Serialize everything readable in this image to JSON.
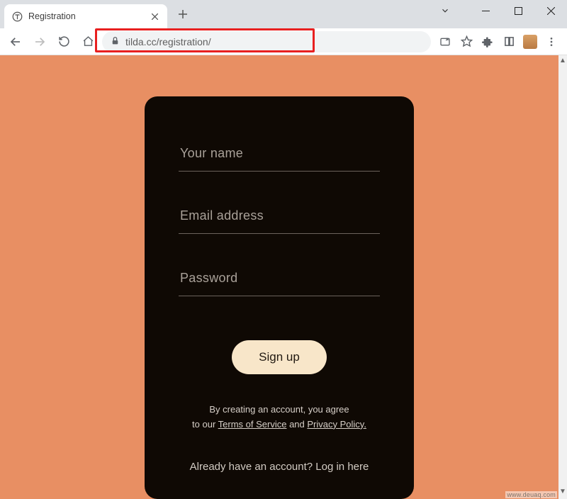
{
  "window": {
    "tab_title": "Registration",
    "url": "tilda.cc/registration/"
  },
  "form": {
    "name_placeholder": "Your name",
    "email_placeholder": "Email address",
    "password_placeholder": "Password",
    "signup_label": "Sign up"
  },
  "legal": {
    "line1": "By creating an account, you agree",
    "line2_prefix": "to our ",
    "tos": "Terms of Service",
    "and": " and ",
    "privacy": "Privacy Policy."
  },
  "login": {
    "prompt": "Already have an account? ",
    "action": "Log in here"
  },
  "watermark": "www.deuaq.com"
}
